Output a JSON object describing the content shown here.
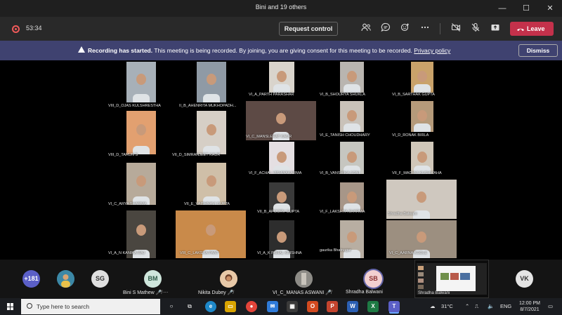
{
  "window": {
    "title": "Bini and 19 others",
    "minimize": "—",
    "maximize": "☐",
    "close": "✕"
  },
  "meeting": {
    "timer": "53:34",
    "request_control": "Request control",
    "leave": "Leave",
    "icons": [
      "people-icon",
      "chat-icon",
      "reactions-icon",
      "more-icon",
      "camera-off-icon",
      "mic-off-icon",
      "share-icon"
    ]
  },
  "banner": {
    "title": "Recording has started.",
    "message": "This meeting is being recorded. By joining, you are giving consent for this meeting to be recorded.",
    "link": "Privacy policy",
    "dismiss": "Dismiss"
  },
  "tiles": [
    {
      "name": "VIII_D_OJAS KULSHRESTHA",
      "bg": "#a7b0b8"
    },
    {
      "name": "II_B_AHENRITA MUKHOPADH...",
      "bg": "#8f9aa5"
    },
    {
      "name": "VI_A_PARTH PARASHAR",
      "bg": "#d9d4cc"
    },
    {
      "name": "VI_B_SHOURYA SHUKLA",
      "bg": "#b9b5b0"
    },
    {
      "name": "VI_B_SARTHAK GUPTA",
      "bg": "#c9a26a"
    },
    {
      "name": "VIII_D_TARUN S",
      "bg": "#e2a070"
    },
    {
      "name": "VII_D_SIMRANJEET KAUR",
      "bg": "#d6cfc6"
    },
    {
      "name": "VI_C_MANSLERAT KAUR",
      "bg": "#5d4a45"
    },
    {
      "name": "VI_E_TANISH CHOUDHARY",
      "bg": "#c9c2b9"
    },
    {
      "name": "VI_D_RONAK BIRLA",
      "bg": "#b59a7a"
    },
    {
      "name": "VI_F_ACHAL VISHWAKARMA",
      "bg": "#e4dfe2"
    },
    {
      "name": "VI_B_VANSHIKA SONI",
      "bg": "#c6c6c0"
    },
    {
      "name": "VII_F_MADHVI KUSHWAHA",
      "bg": "#d0c7b9"
    },
    {
      "name": "VI_C_ARYA SHARMA",
      "bg": "#b7aa9a"
    },
    {
      "name": "VII_E_VAISHNAVI GUPTA",
      "bg": "#cfbfa8"
    },
    {
      "name": "VII_B_APOORV GUPTA",
      "bg": "#3a3a3a"
    },
    {
      "name": "VI_F_LAKSHYA SHARMA",
      "bg": "#a79688"
    },
    {
      "name": "Shradha Balwani",
      "bg": "#cfc8bf"
    },
    {
      "name": "VI_A_N KANIKA RAJ",
      "bg": "#4a4640"
    },
    {
      "name": "VIII_C_LAKSHA PANT",
      "bg": "#c98a4a"
    },
    {
      "name": "VI_A_K PAHAL KRISHNA",
      "bg": "#2d2d2d"
    },
    {
      "name": "gaurika Bhatnagar",
      "bg": "#b8aea2"
    },
    {
      "name": "VI_C_AARNA KODLE",
      "bg": "#9c8f80"
    }
  ],
  "dock": {
    "overflow": "+181",
    "participants": [
      {
        "initials": "SG",
        "name": ""
      },
      {
        "initials": "BM",
        "name": "Bini S Mathew"
      },
      {
        "initials": "",
        "name": "Nikita Dubey"
      },
      {
        "initials": "",
        "name": "VI_C_MANAS ASWANI"
      },
      {
        "initials": "SB",
        "name": "Shradha Balwani"
      },
      {
        "initials": "VK",
        "name": ""
      }
    ],
    "thumb_label": "Shradha Balwani"
  },
  "taskbar": {
    "search_placeholder": "Type here to search",
    "weather": "31°C",
    "lang": "ENG",
    "time": "12:00 PM",
    "date": "8/7/2021"
  },
  "colors": {
    "accent": "#6264a7",
    "leave": "#c4314b",
    "banner": "#3f4270"
  }
}
